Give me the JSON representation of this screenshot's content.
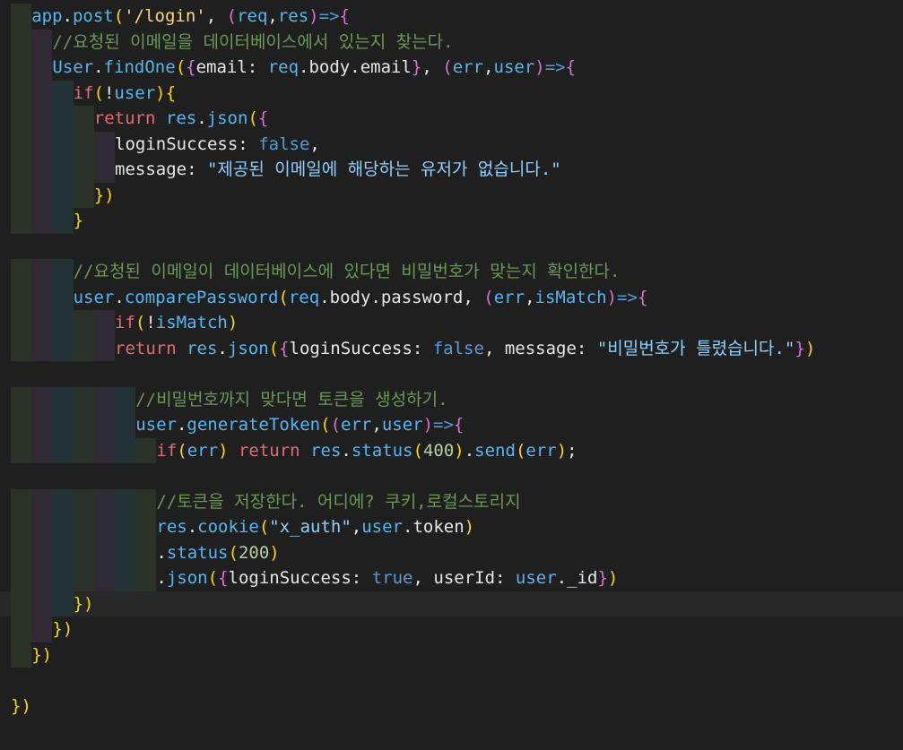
{
  "editor": {
    "language": "javascript",
    "current_line_index": 23,
    "lines": [
      "app.post('/login', (req,res)=>{",
      "//요청된 이메일을 데이터베이스에서 있는지 찾는다.",
      "User.findOne({email: req.body.email}, (err,user)=>{",
      "if(!user){",
      "return res.json({",
      "loginSuccess: false,",
      "message: \"제공된 이메일에 해당하는 유저가 없습니다.\"",
      "})",
      "}",
      "",
      "//요청된 이메일이 데이터베이스에 있다면 비밀번호가 맞는지 확인한다.",
      "user.comparePassword(req.body.password, (err,isMatch)=>{",
      "if(!isMatch)",
      "return res.json({loginSuccess: false, message: \"비밀번호가 틀렸습니다.\"})",
      "",
      "//비밀번호까지 맞다면 토큰을 생성하기.",
      "user.generateToken((err,user)=>{",
      "if(err) return res.status(400).send(err);",
      "",
      "//토큰을 저장한다. 어디에? 쿠키,로컬스토리지",
      "res.cookie(\"x_auth\",user.token)",
      ".status(200)",
      ".json({loginSuccess: true, userId: user._id})",
      "})",
      "})",
      "})",
      "",
      "})"
    ]
  },
  "colors": {
    "background": "#1f1f1f",
    "current_line": "#282828",
    "keyword": "#e06c75",
    "function": "#56b6f2",
    "string": "#ffd580",
    "string_alt": "#8fd0ff",
    "comment": "#6a9955",
    "number": "#b5cea8",
    "boolean": "#569cd6",
    "bracket_1": "#ffd700",
    "bracket_2": "#da70d6",
    "bracket_3": "#179fff",
    "text": "#e8e8e8",
    "indent_guide_1": "#2b3326",
    "indent_guide_2": "#2f2a36",
    "indent_guide_3": "#233335"
  }
}
